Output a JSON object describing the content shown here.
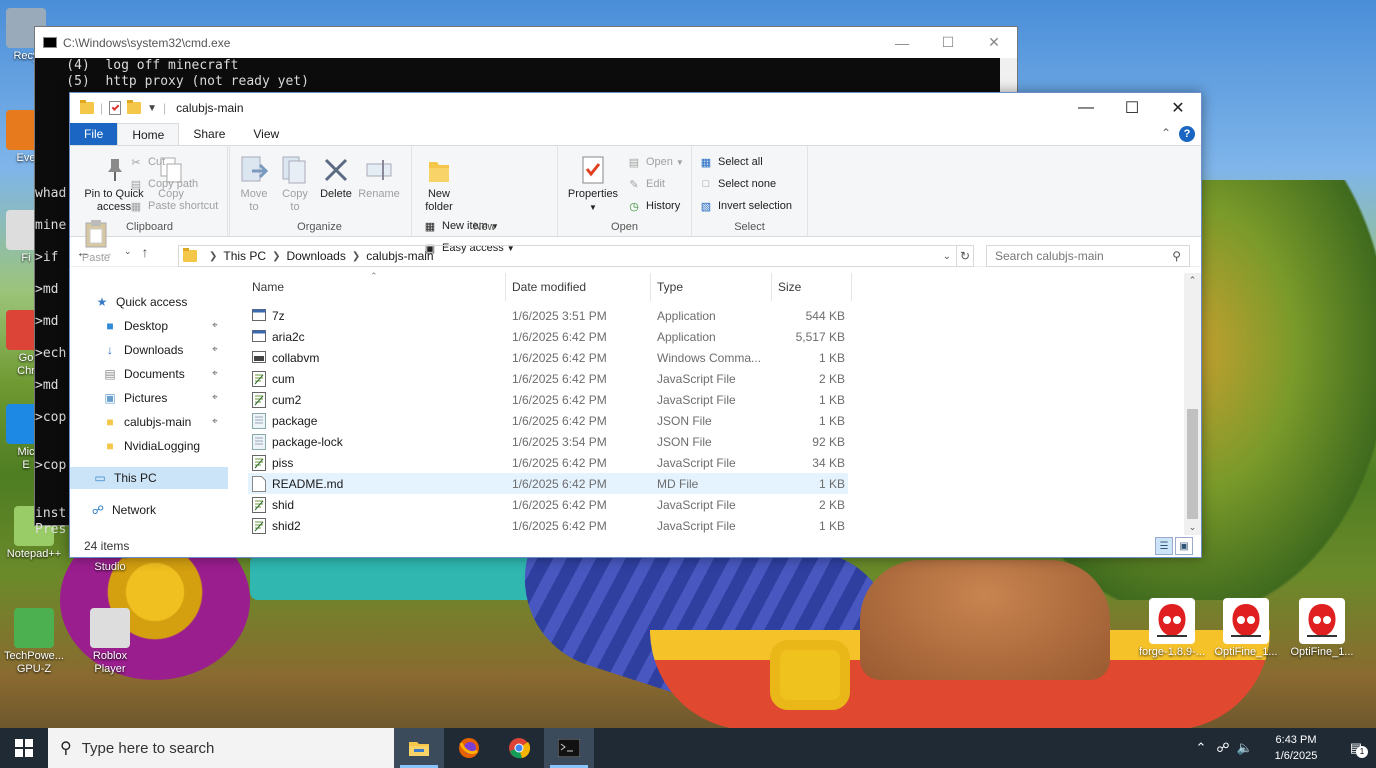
{
  "desktop": {
    "icons_left": [
      {
        "label": "Recy",
        "icon": "recycle-bin-icon",
        "color": "#9ab"
      },
      {
        "label": "Eve",
        "icon": "app-icon",
        "color": "#e87a1e"
      },
      {
        "label": "Fi",
        "icon": "app-icon",
        "color": "#ddd"
      },
      {
        "label": "Go\nChr",
        "icon": "chrome-icon",
        "color": "#db4437"
      },
      {
        "label": "Mic\nE",
        "icon": "edge-icon",
        "color": "#1e88e5"
      },
      {
        "label": "Notepad++",
        "icon": "notepadpp-icon",
        "color": "#9c6"
      },
      {
        "label": "Roblox\nStudio",
        "icon": "roblox-studio-icon",
        "color": "#1da1f2"
      },
      {
        "label": "TechPowe...\nGPU-Z",
        "icon": "gpuz-icon",
        "color": "#4caf50"
      },
      {
        "label": "Roblox\nPlayer",
        "icon": "roblox-icon",
        "color": "#ddd"
      }
    ],
    "icons_right": [
      {
        "label": "forge-1.8.9-...",
        "icon": "java-icon"
      },
      {
        "label": "OptiFine_1...",
        "icon": "java-icon"
      },
      {
        "label": "OptiFine_1...",
        "icon": "java-icon"
      }
    ]
  },
  "cmd": {
    "title": "C:\\Windows\\system32\\cmd.exe",
    "lines": [
      "    (4)  log off minecraft",
      "    (5)  http proxy (not ready yet)"
    ],
    "left_fragments": [
      "whad",
      "mine",
      ">if",
      ">md",
      ">md",
      ">ech",
      ">md",
      ">cop",
      ">cop",
      "inst",
      "Pres"
    ]
  },
  "explorer": {
    "title": "calubjs-main",
    "tabs": [
      "File",
      "Home",
      "Share",
      "View"
    ],
    "ribbon": {
      "clipboard": {
        "label": "Clipboard",
        "pin": "Pin to Quick\naccess",
        "copy": "Copy",
        "paste": "Paste",
        "cut": "Cut",
        "copy_path": "Copy path",
        "paste_shortcut": "Paste shortcut"
      },
      "organize": {
        "label": "Organize",
        "move_to": "Move\nto",
        "copy_to": "Copy\nto",
        "delete": "Delete",
        "rename": "Rename"
      },
      "new": {
        "label": "New",
        "new_folder": "New\nfolder",
        "new_item": "New item",
        "easy_access": "Easy access"
      },
      "open": {
        "label": "Open",
        "properties": "Properties",
        "open": "Open",
        "edit": "Edit",
        "history": "History"
      },
      "select": {
        "label": "Select",
        "select_all": "Select all",
        "select_none": "Select none",
        "invert": "Invert selection"
      }
    },
    "path": [
      "This PC",
      "Downloads",
      "calubjs-main"
    ],
    "search_placeholder": "Search calubjs-main",
    "nav": [
      {
        "label": "Quick access",
        "icon": "star-icon",
        "pinned": false
      },
      {
        "label": "Desktop",
        "icon": "desktop-icon",
        "pinned": true
      },
      {
        "label": "Downloads",
        "icon": "download-icon",
        "pinned": true
      },
      {
        "label": "Documents",
        "icon": "documents-icon",
        "pinned": true
      },
      {
        "label": "Pictures",
        "icon": "pictures-icon",
        "pinned": true
      },
      {
        "label": "calubjs-main",
        "icon": "folder-icon",
        "pinned": true
      },
      {
        "label": "NvidiaLogging",
        "icon": "folder-icon",
        "pinned": false
      },
      {
        "label": "This PC",
        "icon": "computer-icon",
        "pinned": false
      },
      {
        "label": "Network",
        "icon": "network-icon",
        "pinned": false
      }
    ],
    "columns": {
      "name": "Name",
      "date": "Date modified",
      "type": "Type",
      "size": "Size"
    },
    "files": [
      {
        "name": "7z",
        "date": "1/6/2025 3:51 PM",
        "type": "Application",
        "size": "544 KB",
        "icon": "app"
      },
      {
        "name": "aria2c",
        "date": "1/6/2025 6:42 PM",
        "type": "Application",
        "size": "5,517 KB",
        "icon": "app"
      },
      {
        "name": "collabvm",
        "date": "1/6/2025 6:42 PM",
        "type": "Windows Comma...",
        "size": "1 KB",
        "icon": "cmd"
      },
      {
        "name": "cum",
        "date": "1/6/2025 6:42 PM",
        "type": "JavaScript File",
        "size": "2 KB",
        "icon": "js"
      },
      {
        "name": "cum2",
        "date": "1/6/2025 6:42 PM",
        "type": "JavaScript File",
        "size": "1 KB",
        "icon": "js"
      },
      {
        "name": "package",
        "date": "1/6/2025 6:42 PM",
        "type": "JSON File",
        "size": "1 KB",
        "icon": "json"
      },
      {
        "name": "package-lock",
        "date": "1/6/2025 3:54 PM",
        "type": "JSON File",
        "size": "92 KB",
        "icon": "json"
      },
      {
        "name": "piss",
        "date": "1/6/2025 6:42 PM",
        "type": "JavaScript File",
        "size": "34 KB",
        "icon": "js"
      },
      {
        "name": "README.md",
        "date": "1/6/2025 6:42 PM",
        "type": "MD File",
        "size": "1 KB",
        "icon": "doc"
      },
      {
        "name": "shid",
        "date": "1/6/2025 6:42 PM",
        "type": "JavaScript File",
        "size": "2 KB",
        "icon": "js"
      },
      {
        "name": "shid2",
        "date": "1/6/2025 6:42 PM",
        "type": "JavaScript File",
        "size": "1 KB",
        "icon": "js"
      }
    ],
    "status": "24 items"
  },
  "taskbar": {
    "search_placeholder": "Type here to search",
    "time": "6:43 PM",
    "date": "1/6/2025",
    "notifications": "1"
  }
}
